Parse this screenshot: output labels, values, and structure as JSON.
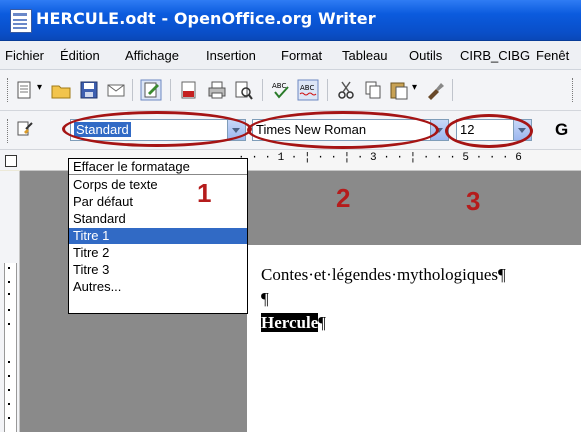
{
  "window": {
    "title": "HERCULE.odt - OpenOffice.org Writer"
  },
  "menu": [
    "Fichier",
    "Édition",
    "Affichage",
    "Insertion",
    "Format",
    "Tableau",
    "Outils",
    "CIRB_CIBG",
    "Fenêt"
  ],
  "format_toolbar": {
    "style_value": "Standard",
    "font_value": "Times New Roman",
    "size_value": "12",
    "bold_label": "G"
  },
  "style_list": {
    "items": [
      "Effacer le formatage",
      "Corps de texte",
      "Par défaut",
      "Standard",
      "Titre 1",
      "Titre 2",
      "Titre 3",
      "Autres..."
    ],
    "selected": "Titre 1"
  },
  "annotations": [
    "1",
    "2",
    "3"
  ],
  "ruler": {
    "marks": "· · · 1 · ¦ · · ¦ · 3 · · ¦ · · · 5 · · · 6"
  },
  "document": {
    "line1": "Contes·et·légendes·mythologiques¶",
    "line2": "¶",
    "line3_highlight": "Hercule",
    "line3_mark": "¶"
  },
  "colors": {
    "titlebar": "#0b5bde",
    "selection": "#316ac5",
    "annotation": "#b51c1c"
  }
}
